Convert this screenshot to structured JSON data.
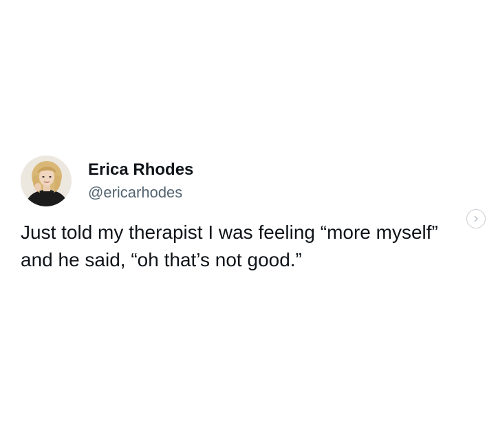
{
  "tweet": {
    "author": {
      "display_name": "Erica Rhodes",
      "handle": "@ericarhodes",
      "avatar_icon": "profile-photo"
    },
    "text": "Just told my therapist I was feeling “more myself” and he said, “oh that’s not good.”"
  },
  "carousel": {
    "next_icon": "chevron-right-icon"
  },
  "colors": {
    "background": "#ffffff",
    "primary_text": "#0f1419",
    "secondary_text": "#536471",
    "button_border": "#c9ced3"
  }
}
